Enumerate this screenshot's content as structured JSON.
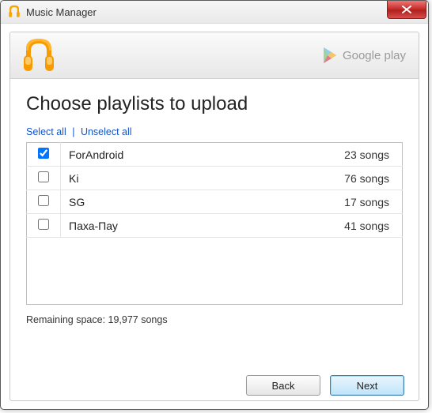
{
  "titlebar": {
    "title": "Music Manager"
  },
  "brand": {
    "label": "Google play"
  },
  "heading": "Choose playlists to upload",
  "links": {
    "select_all": "Select all",
    "unselect_all": "Unselect all"
  },
  "playlists": [
    {
      "checked": true,
      "name": "ForAndroid",
      "count": "23 songs"
    },
    {
      "checked": false,
      "name": "Ki",
      "count": "76 songs"
    },
    {
      "checked": false,
      "name": "SG",
      "count": "17 songs"
    },
    {
      "checked": false,
      "name": "Паха-Пау",
      "count": "41 songs"
    }
  ],
  "remaining": "Remaining space: 19,977 songs",
  "buttons": {
    "back": "Back",
    "next": "Next"
  }
}
